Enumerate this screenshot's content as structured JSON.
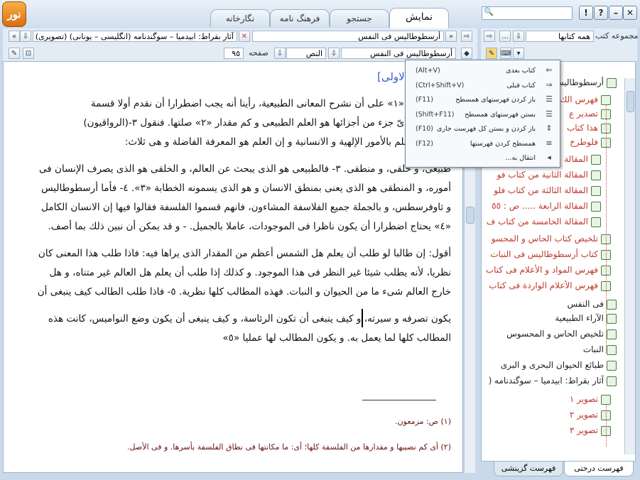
{
  "app": {
    "logo_text": "نور"
  },
  "tabs": [
    {
      "label": "نمایش",
      "active": true
    },
    {
      "label": "جستجو",
      "active": false
    },
    {
      "label": "فرهنگ نامه",
      "active": false
    },
    {
      "label": "نگارخانه",
      "active": false
    }
  ],
  "window_buttons": {
    "help": "?",
    "info": "!",
    "close": "✕",
    "minimize": "–"
  },
  "address_bar": {
    "title_field": "أرسطوطاليس فى النفس",
    "second_field": "آثار بقراط: ابيدميا – سوگندنامه (انگليسی – يونانی) (تصويری)",
    "nav_back": "⇨",
    "nav_fwd": "⇦"
  },
  "toolbar2": {
    "book_field": "أرسطوطاليس فى النفس",
    "section_field": "النص",
    "page_label": "صفحه",
    "page_value": "٩٥"
  },
  "tree_toolbar": {
    "group_label": "مجموعه کتب",
    "group_value": "همه کتابها"
  },
  "document": {
    "header_fragment": "الاولى]",
    "lines": [
      "كنا مزمعين «١» على أن نشرح المعانى الطبيعية، رأينا أنه يجب اضطرارا أن نقدم أولا قسمة",
      "سفة ليعلم أىّ جزء من أجزائها هو العلم الطبيعى و كم مقدار «٢» صلتها. فنقول ٣-(الرواقيون)",
      "سفة إنها العلم بالأمور الإلهية و الانسانية و إن العلم هو المعرفة الفاضلة و هى ثلاث:",
      "طبيعى، و خلقى، و منطقى. ٣- فالطبيعى هو الذى يبحث عن العالم، و الخلقى هو الذى يصرف الإنسان فى",
      "أموره، و المنطقى هو الذى يعنى بمنطق الانسان و هو الذى يسمونه الخطابة «٣». ٤- فأما أرسطوطاليس",
      "و ثاوفرسطس، و بالجملة جميع الفلاسفة المشاءون، فانهم قسموا الفلسفة فقالوا فيها إن الانسان الكامل",
      "«٤» يحتاج اضطرارا أن يكون ناظرا فى الموجودات، عاملا بالجميل. - و قد يمكن أن نبين ذلك بما أصف.",
      "أقول: إن طالبا لو طلب أن يعلم هل الشمس أعظم من المقدار الذى يراها فيه: فاذا طلب هذا المعنى كان",
      "نظريا، لأنه يطلب شيئا غير النظر فى هذا الموجود. و كذلك إذا طلب أن يعلم هل العالم غير متناه، و هل",
      "خارج العالم شىء ما من الحيوان و النبات. فهذه المطالب كلها نظرية. ٥- فاذا طلب الطالب كيف ينبغى أن",
      "يكون تصرفه و سيرته، و كيف ينبغى أن تكون الرئاسة، و كيف ينبغى أن يكون وضع النواميس، كانت هذه",
      "المطالب كلها لما يعمل به. و يكون المطالب لها عمليا «٥»"
    ],
    "footnotes": [
      "(١) ص: مزمعون.",
      "(٢) أى كم نصيبها و مقدارها من الفلسفة كلها؛ أى: ما مكانتها فى نطاق الفلسفة بأسرها. و فى الأصل."
    ]
  },
  "context_menu": {
    "items": [
      {
        "label": "کتاب بعدی",
        "shortcut": "(Alt+V)",
        "icon": "next-book-icon"
      },
      {
        "label": "کتاب قبلی",
        "shortcut": "(Ctrl+Shift+V)",
        "icon": "prev-book-icon"
      },
      {
        "label": "باز کردن فهرستهای همسطح",
        "shortcut": "(F11)",
        "icon": "expand-level-icon"
      },
      {
        "label": "بستن فهرستهای همسطح",
        "shortcut": "(Shift+F11)",
        "icon": "collapse-level-icon"
      },
      {
        "label": "باز کردن و بستن کل فهرست جاری",
        "shortcut": "(F10)",
        "icon": "toggle-all-icon"
      },
      {
        "label": "همسطح کردن فهرستها",
        "shortcut": "(F12)",
        "icon": "flatten-icon"
      },
      {
        "label": "انتقال به...",
        "shortcut": "",
        "icon": "submenu-arrow-icon"
      }
    ]
  },
  "tree": {
    "nodes": [
      {
        "label": "أرسطوطاليس",
        "color": "#222222",
        "depth": 0
      },
      {
        "label": "فهرس الك",
        "color": "#c0392b",
        "depth": 1
      },
      {
        "label": "تصدير ع",
        "color": "#c0392b",
        "depth": 1
      },
      {
        "label": "هذا كتاب",
        "color": "#c0392b",
        "depth": 1
      },
      {
        "label": "فلوطرخ",
        "color": "#c0392b",
        "depth": 1
      },
      {
        "label": "المقالة",
        "color": "#c0392b",
        "depth": 2
      },
      {
        "label": "المقالة الثانية من كتاب فو",
        "color": "#c0392b",
        "depth": 2
      },
      {
        "label": "المقالة الثالثة من كتاب فلو",
        "color": "#c0392b",
        "depth": 2
      },
      {
        "label": "المقالة الرابعة ..... ص : ٥٥",
        "color": "#c0392b",
        "depth": 2
      },
      {
        "label": "المقالة الخامسة من كتاب ف",
        "color": "#c0392b",
        "depth": 2
      },
      {
        "label": "تلخيص كتاب الحاس و المحسو",
        "color": "#c0392b",
        "depth": 1
      },
      {
        "label": "كتاب أرسطوطاليس فى النبات",
        "color": "#c0392b",
        "depth": 1
      },
      {
        "label": "فهرس المواد و الأعلام فى كتاب",
        "color": "#c0392b",
        "depth": 1
      },
      {
        "label": "فهرس الأعلام الواردة فى كتاب",
        "color": "#c0392b",
        "depth": 1
      },
      {
        "label": "فى النفس",
        "color": "#222222",
        "depth": 0
      },
      {
        "label": "الآراء الطبيعية",
        "color": "#222222",
        "depth": 0
      },
      {
        "label": "تلخيص الحاس و المحسوس",
        "color": "#222222",
        "depth": 0
      },
      {
        "label": "النبات",
        "color": "#222222",
        "depth": 0
      },
      {
        "label": "طبائع الحيوان البحرى و البرى",
        "color": "#222222",
        "depth": 0
      },
      {
        "label": "آثار بقراط: ابيدميا – سوگندنامه (",
        "color": "#222222",
        "depth": 0
      },
      {
        "label": "تصوير ١",
        "color": "#c0392b",
        "depth": 1
      },
      {
        "label": "تصوير ٢",
        "color": "#c0392b",
        "depth": 1
      },
      {
        "label": "تصوير ٣",
        "color": "#c0392b",
        "depth": 1
      }
    ]
  },
  "bottom_tabs": [
    {
      "label": "فهرست درختی",
      "active": true
    },
    {
      "label": "فهرست گزینشی",
      "active": false
    }
  ]
}
